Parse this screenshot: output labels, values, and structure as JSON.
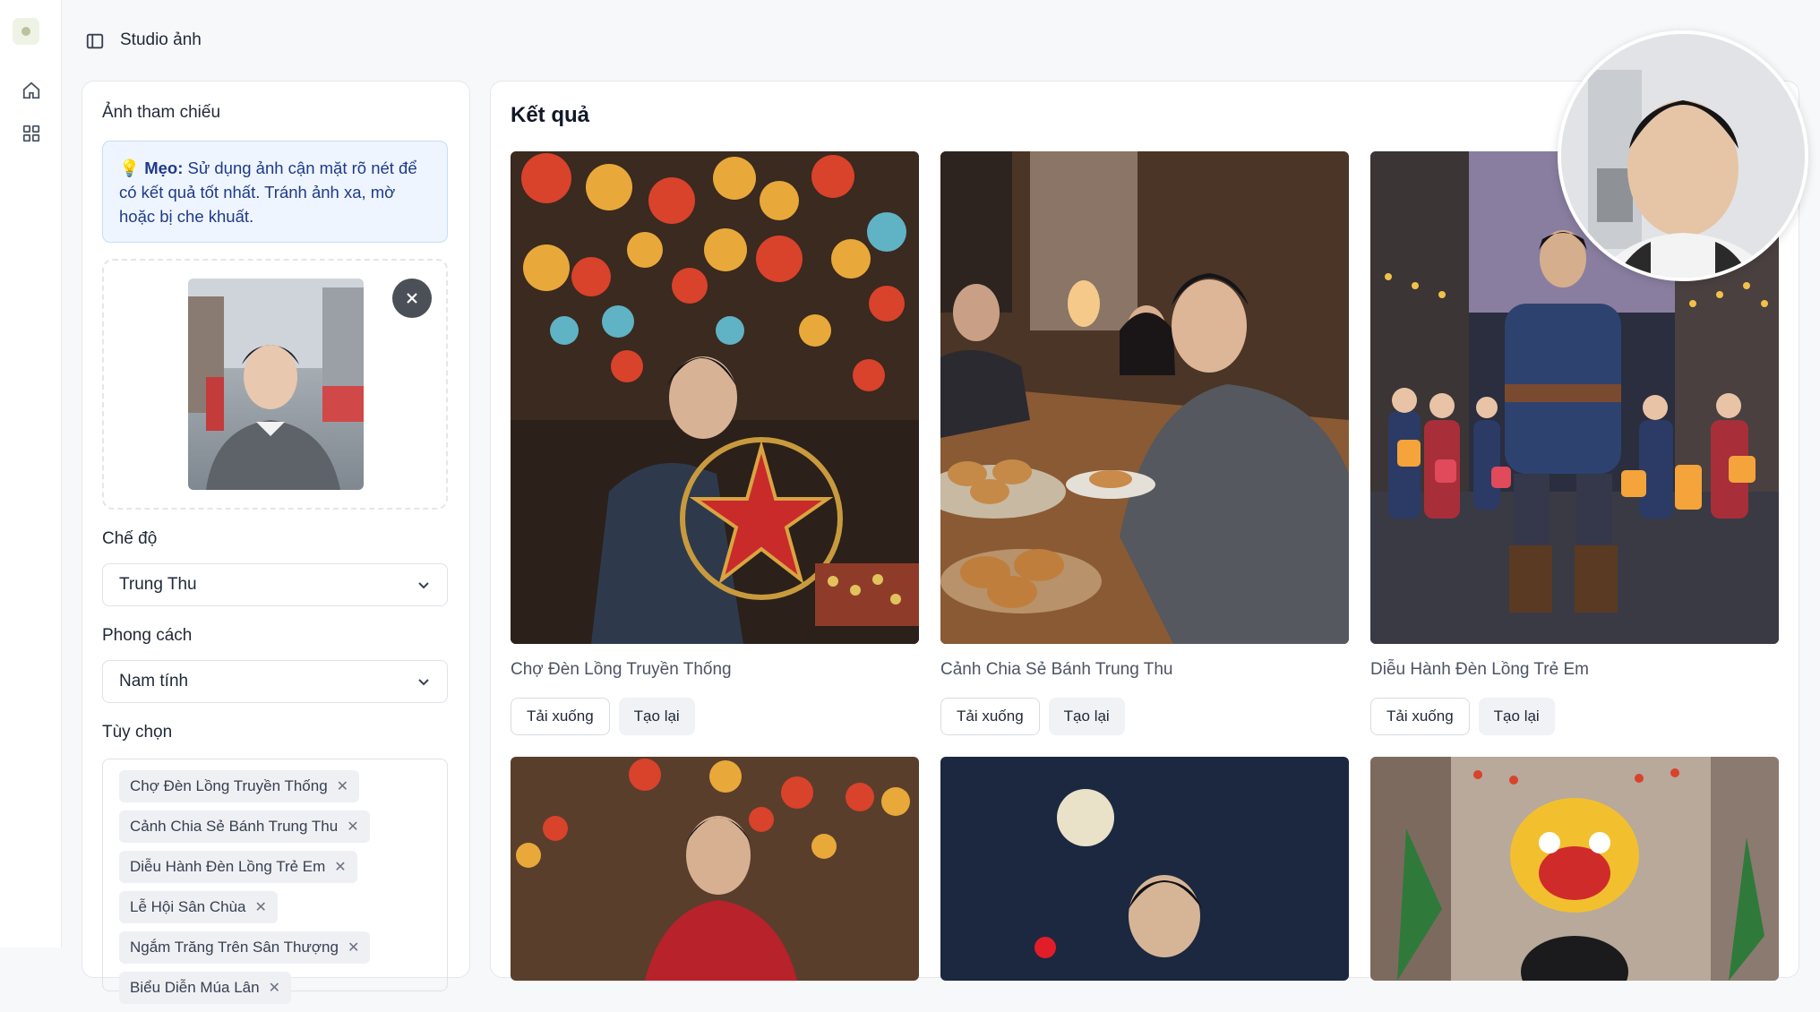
{
  "app": {
    "title": "Studio ảnh"
  },
  "left_panel": {
    "reference_label": "Ảnh tham chiếu",
    "tip_prefix": "Mẹo:",
    "tip_text": " Sử dụng ảnh cận mặt rõ nét để có kết quả tốt nhất. Tránh ảnh xa, mờ hoặc bị che khuất.",
    "mode_label": "Chế độ",
    "mode_value": "Trung Thu",
    "style_label": "Phong cách",
    "style_value": "Nam tính",
    "options_label": "Tùy chọn",
    "options": [
      "Chợ Đèn Lồng Truyền Thống",
      "Cảnh Chia Sẻ Bánh Trung Thu",
      "Diễu Hành Đèn Lồng Trẻ Em",
      "Lễ Hội Sân Chùa",
      "Ngắm Trăng Trên Sân Thượng",
      "Biểu Diễn Múa Lân"
    ]
  },
  "results": {
    "heading": "Kết quả",
    "download_label": "Tải xuống",
    "regenerate_label": "Tạo lại",
    "cards": [
      {
        "caption": "Chợ Đèn Lồng Truyền Thống"
      },
      {
        "caption": "Cảnh Chia Sẻ Bánh Trung Thu"
      },
      {
        "caption": "Diễu Hành Đèn Lồng Trẻ Em"
      }
    ]
  },
  "colors": {
    "tip_bg": "#eef5fe",
    "tip_text": "#1e3a8a",
    "lantern_red": "#d9422b",
    "lantern_gold": "#e8a93a"
  }
}
